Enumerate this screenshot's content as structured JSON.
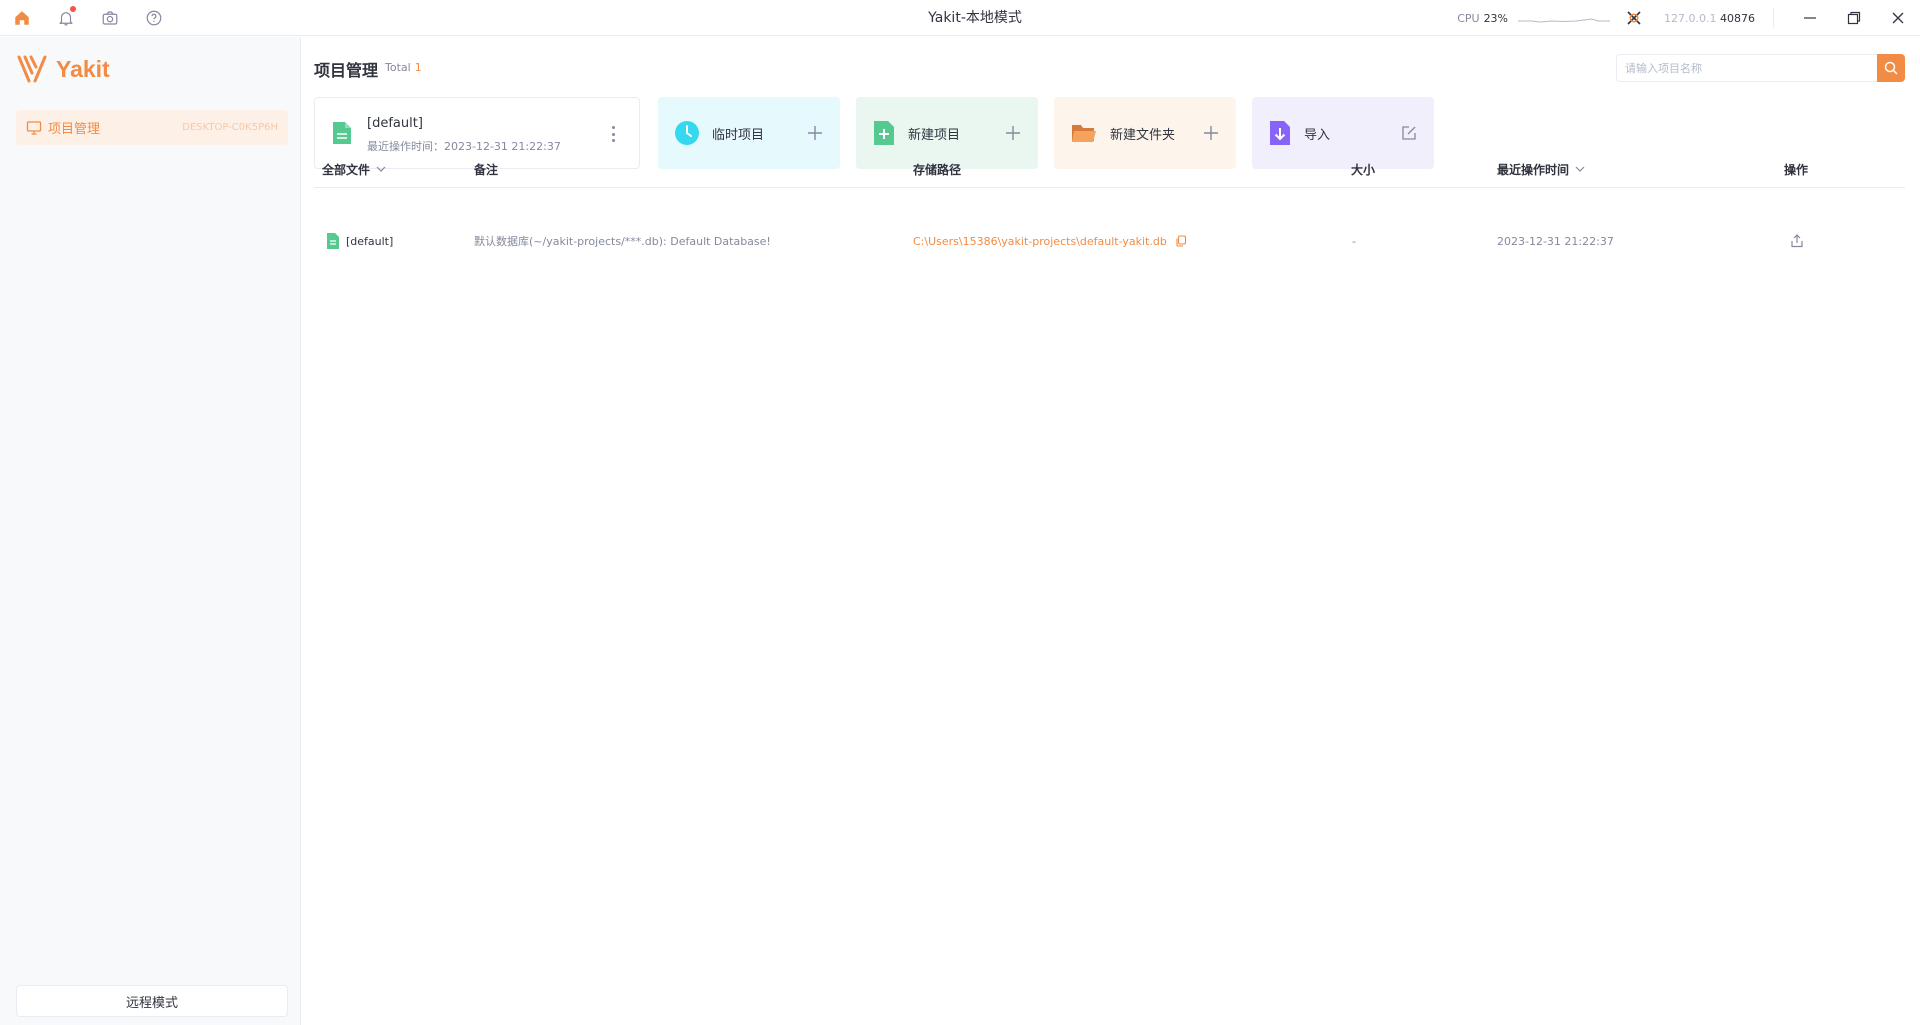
{
  "window": {
    "title": "Yakit-本地模式",
    "cpu_label": "CPU",
    "cpu_value": "23%",
    "host_ip": "127.0.0.1",
    "host_port": "40876"
  },
  "sidebar": {
    "logo_text": "Yakit",
    "items": [
      {
        "label": "项目管理",
        "host": "DESKTOP-C0K5P6H",
        "icon": "monitor-icon"
      }
    ],
    "remote_mode_label": "远程模式"
  },
  "main": {
    "title": "项目管理",
    "total_label": "Total",
    "total_count": "1",
    "search_placeholder": "请输入项目名称",
    "latest_project": {
      "name": "[default]",
      "time_label": "最近操作时间：2023-12-31 21:22:37"
    },
    "quick_actions": [
      {
        "label": "临时项目",
        "icon": "clock-icon",
        "bg": "#e6f9fc",
        "action_icon": "plus-icon"
      },
      {
        "label": "新建项目",
        "icon": "add-file-icon",
        "bg": "#e9f7f0",
        "action_icon": "plus-icon"
      },
      {
        "label": "新建文件夹",
        "icon": "folder-icon",
        "bg": "#fdf4ec",
        "action_icon": "plus-icon"
      },
      {
        "label": "导入",
        "icon": "import-icon",
        "bg": "#f1effc",
        "action_icon": "edit-icon"
      }
    ],
    "table": {
      "columns": {
        "files": "全部文件",
        "remark": "备注",
        "path": "存储路径",
        "size": "大小",
        "time": "最近操作时间",
        "ops": "操作"
      },
      "rows": [
        {
          "name": "[default]",
          "remark": "默认数据库(~/yakit-projects/***.db): Default Database!",
          "path": "C:\\Users\\15386\\yakit-projects\\default-yakit.db",
          "size": "-",
          "time": "2023-12-31 21:22:37"
        }
      ]
    }
  },
  "colors": {
    "accent": "#f28b44",
    "green": "#56c991",
    "cyan": "#35d8ee",
    "purple": "#8863f7"
  }
}
